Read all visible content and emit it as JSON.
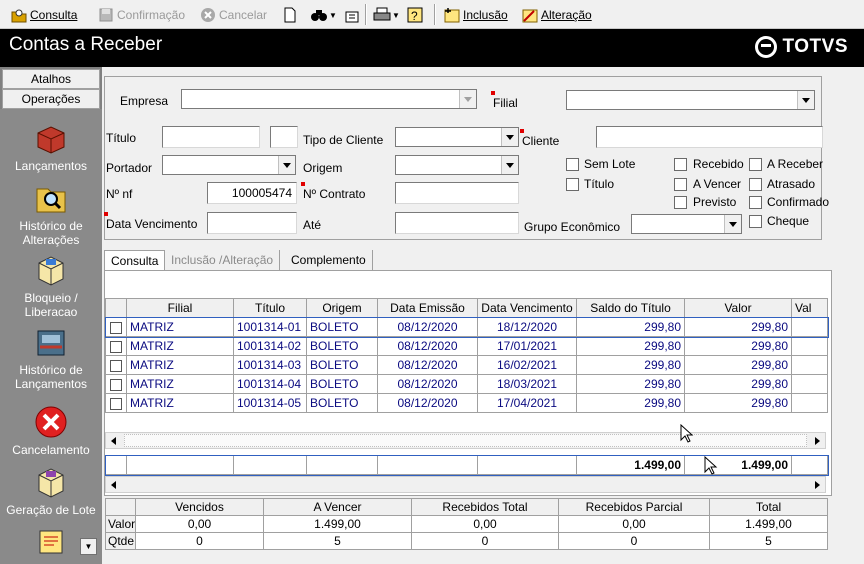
{
  "toolbar": {
    "consulta": "Consulta",
    "confirmacao": "Confirmação",
    "cancelar": "Cancelar",
    "inclusao": "Inclusão",
    "alteracao": "Alteração"
  },
  "title": "Contas a Receber",
  "brand": "TOTVS",
  "sidebar": {
    "atalhos": "Atalhos",
    "operacoes": "Operações",
    "items": [
      {
        "label": "Lançamentos"
      },
      {
        "label": "Histórico de Alterações"
      },
      {
        "label": "Bloqueio / Liberacao"
      },
      {
        "label": "Histórico de Lançamentos"
      },
      {
        "label": "Cancelamento"
      },
      {
        "label": "Geração de Lote"
      }
    ]
  },
  "form": {
    "empresa": "Empresa",
    "filial": "Filial",
    "titulo": "Título",
    "tipo_cliente": "Tipo de Cliente",
    "cliente": "Cliente",
    "portador": "Portador",
    "origem": "Origem",
    "nf": "Nº nf",
    "nf_value": "100005474",
    "contrato": "Nº Contrato",
    "data_venc": "Data Vencimento",
    "ate": "Até",
    "grupo": "Grupo Econômico",
    "checks": {
      "sem_lote": "Sem Lote",
      "titulo": "Título",
      "recebido": "Recebido",
      "a_receber": "A Receber",
      "a_vencer": "A Vencer",
      "atrasado": "Atrasado",
      "previsto": "Previsto",
      "confirmado": "Confirmado",
      "cheque": "Cheque"
    }
  },
  "tabs": [
    "Consulta",
    "Inclusão /Alteração",
    "Complemento"
  ],
  "grid": {
    "headers": [
      "",
      "Filial",
      "Título",
      "Origem",
      "Data Emissão",
      "Data Vencimento",
      "Saldo do Título",
      "Valor",
      "Val"
    ],
    "rows": [
      [
        "MATRIZ",
        "1001314-01",
        "BOLETO",
        "08/12/2020",
        "18/12/2020",
        "299,80",
        "299,80"
      ],
      [
        "MATRIZ",
        "1001314-02",
        "BOLETO",
        "08/12/2020",
        "17/01/2021",
        "299,80",
        "299,80"
      ],
      [
        "MATRIZ",
        "1001314-03",
        "BOLETO",
        "08/12/2020",
        "16/02/2021",
        "299,80",
        "299,80"
      ],
      [
        "MATRIZ",
        "1001314-04",
        "BOLETO",
        "08/12/2020",
        "18/03/2021",
        "299,80",
        "299,80"
      ],
      [
        "MATRIZ",
        "1001314-05",
        "BOLETO",
        "08/12/2020",
        "17/04/2021",
        "299,80",
        "299,80"
      ]
    ],
    "total_saldo": "1.499,00",
    "total_valor": "1.499,00"
  },
  "summary": {
    "headers": [
      "",
      "Vencidos",
      "A Vencer",
      "Recebidos Total",
      "Recebidos Parcial",
      "Total"
    ],
    "valor": [
      "Valor",
      "0,00",
      "1.499,00",
      "0,00",
      "0,00",
      "1.499,00"
    ],
    "qtde": [
      "Qtde",
      "0",
      "5",
      "0",
      "0",
      "5"
    ]
  }
}
